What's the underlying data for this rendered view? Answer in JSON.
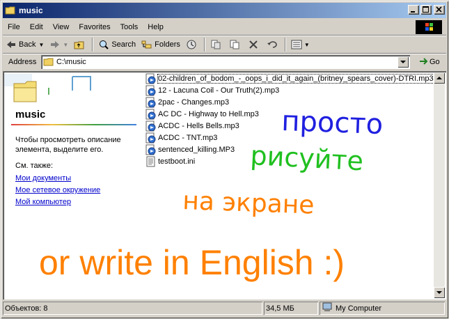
{
  "window": {
    "title": "music"
  },
  "menu": [
    "File",
    "Edit",
    "View",
    "Favorites",
    "Tools",
    "Help"
  ],
  "toolbar": {
    "back": "Back",
    "search": "Search",
    "folders": "Folders"
  },
  "address": {
    "label": "Address",
    "value": "C:\\music",
    "go": "Go"
  },
  "left_panel": {
    "title": "music",
    "description": "Чтобы просмотреть описание элемента, выделите его.",
    "see_also": "См. также:",
    "links": [
      "Мои документы",
      "Мое сетевое окружение",
      "Мой компьютер"
    ]
  },
  "files": [
    {
      "name": "02-children_of_bodom_-_oops_i_did_it_again_(britney_spears_cover)-DTRI.mp3",
      "icon": "audio-file-icon"
    },
    {
      "name": "12 - Lacuna Coil - Our Truth(2).mp3",
      "icon": "audio-file-icon"
    },
    {
      "name": "2pac - Changes.mp3",
      "icon": "audio-file-icon"
    },
    {
      "name": "AC DC - Highway to Hell.mp3",
      "icon": "audio-file-icon"
    },
    {
      "name": "ACDC - Hells Bells.mp3",
      "icon": "audio-file-icon"
    },
    {
      "name": "ACDC - TNT.mp3",
      "icon": "audio-file-icon"
    },
    {
      "name": "sentenced_killing.MP3",
      "icon": "audio-file-icon"
    },
    {
      "name": "testboot.ini",
      "icon": "ini-file-icon"
    }
  ],
  "scribbles": {
    "line1": "просто",
    "line2": "рисуйте",
    "line3": "на экране",
    "english": "or write in English :)",
    "colors": {
      "blue": "#2020e0",
      "green": "#20c020",
      "orange": "#ff8000"
    }
  },
  "status": {
    "objects": "Объектов: 8",
    "size": "34,5 МБ",
    "location": "My Computer"
  }
}
